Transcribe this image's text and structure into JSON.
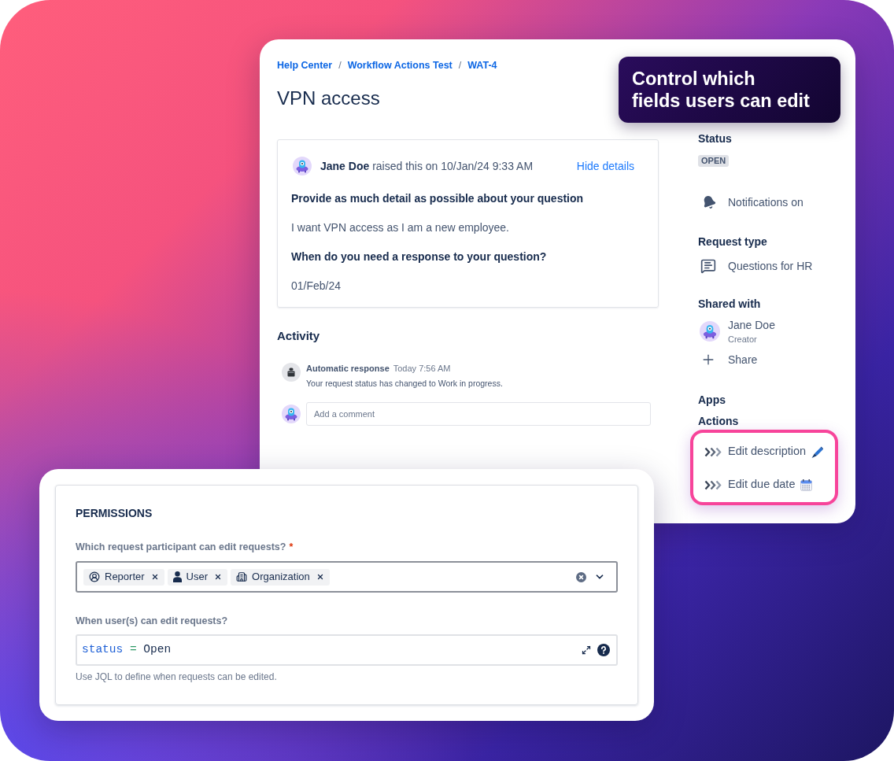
{
  "callout": {
    "lines": [
      "Control which",
      "fields users can edit"
    ]
  },
  "request": {
    "breadcrumbs": [
      {
        "label": "Help Center"
      },
      {
        "label": "Workflow Actions Test"
      },
      {
        "label": "WAT-4"
      }
    ],
    "separators": [
      "/",
      "/"
    ],
    "title": "VPN access",
    "details": {
      "raised_line": "**Jane Doe** raised this on 10/Jan/24 9:33 AM",
      "toggle": "Hide details",
      "fields": [
        {
          "question": "Provide as much detail as possible about your question",
          "answer": "I want VPN access as I am a new employee."
        },
        {
          "question": "When do you need a response to your question?",
          "answer": "01/Feb/24"
        }
      ]
    },
    "activity": {
      "heading": "Activity",
      "items": [
        {
          "author": "Automatic response",
          "time": "Today 7:56 AM",
          "text": "Your request status has changed to Work in progress."
        }
      ],
      "comment": {
        "placeholder": "Add a comment"
      }
    }
  },
  "sidebar": {
    "status": {
      "heading": "Status",
      "value": "OPEN"
    },
    "notifications": "Notifications on",
    "request_type": {
      "heading": "Request type",
      "value": "Questions for HR"
    },
    "shared_with": {
      "heading": "Shared with",
      "people": [
        {
          "name": "Jane Doe",
          "role": "Creator"
        }
      ],
      "share": "Share"
    },
    "apps": {
      "heading": "Apps"
    },
    "actions": {
      "heading": "Actions",
      "items": [
        {
          "label": "Edit description",
          "kind": "description"
        },
        {
          "label": "Edit due date",
          "kind": "due_date"
        }
      ]
    }
  },
  "permissions": {
    "heading": "PERMISSIONS",
    "participants": {
      "label": "Which request participant can edit requests?",
      "required": "*",
      "tags": [
        {
          "label": "Reporter",
          "kind": "reporter"
        },
        {
          "label": "User",
          "kind": "user"
        },
        {
          "label": "Organization",
          "kind": "organization"
        }
      ]
    },
    "condition": {
      "label": "When user(s) can edit requests?",
      "tokens": [
        {
          "text": "status",
          "kind": "field"
        },
        {
          "text": "=",
          "kind": "operator"
        },
        {
          "text": "Open",
          "kind": "value"
        }
      ],
      "help": "Use JQL to define when requests can be edited."
    }
  }
}
